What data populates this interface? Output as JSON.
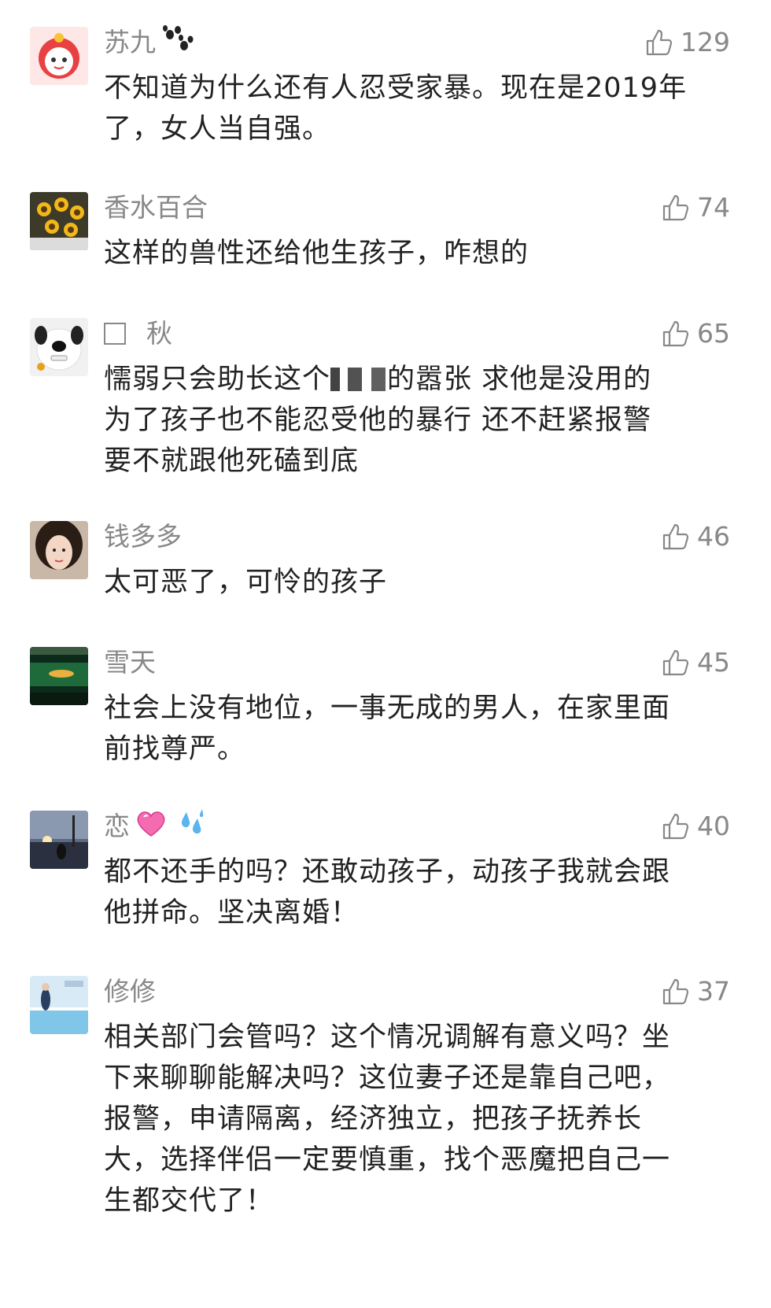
{
  "comments": [
    {
      "name": "苏九",
      "name_emoji": "paw-prints",
      "likes": "129",
      "text": "不知道为什么还有人忍受家暴。现在是2019年\n了，女人当自强。"
    },
    {
      "name": "香水百合",
      "likes": "74",
      "text": "这样的兽性还给他生孩子，咋想的"
    },
    {
      "name": "秋",
      "name_prefix": "checkbox-square",
      "likes": "65",
      "text_before": "懦弱只会助长这个",
      "text_after": "的嚣张 求他是没用的\n为了孩子也不能忍受他的暴行 还不赶紧报警\n要不就跟他死磕到底"
    },
    {
      "name": "钱多多",
      "likes": "46",
      "text": "太可恶了，可怜的孩子"
    },
    {
      "name": "雪天",
      "likes": "45",
      "text": "社会上没有地位，一事无成的男人，在家里面\n前找尊严。"
    },
    {
      "name": "恋",
      "name_emoji": "pink-heart sweat-droplets",
      "likes": "40",
      "text": "都不还手的吗？还敢动孩子，动孩子我就会跟\n他拼命。坚决离婚！"
    },
    {
      "name": "修修",
      "likes": "37",
      "text": "相关部门会管吗？这个情况调解有意义吗？坐\n下来聊聊能解决吗？这位妻子还是靠自己吧，\n报警，申请隔离，经济独立，把孩子抚养长\n大，选择伴侣一定要慎重，找个恶魔把自己一\n生都交代了！"
    }
  ],
  "colors": {
    "name": "#888888",
    "text": "#222222",
    "like": "#888888"
  }
}
